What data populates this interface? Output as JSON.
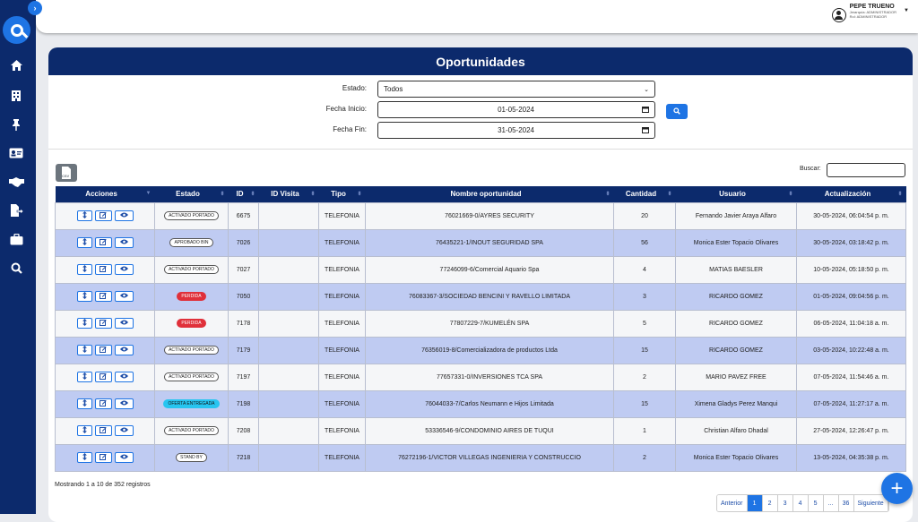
{
  "user": {
    "name": "PEPE TRUENO",
    "role_line": "Jerarquía: ADMINISTRADOR",
    "rol_line": "Rol: ADMINISTRADOR"
  },
  "page_title": "Oportunidades",
  "filters": {
    "estado_label": "Estado:",
    "estado_value": "Todos",
    "fecha_inicio_label": "Fecha Inicio:",
    "fecha_inicio_value": "01-05-2024",
    "fecha_fin_label": "Fecha Fin:",
    "fecha_fin_value": "31-05-2024"
  },
  "search_label": "Buscar:",
  "csv_label": "CSV",
  "columns": [
    "Acciones",
    "Estado",
    "ID",
    "ID Visita",
    "Tipo",
    "Nombre oportunidad",
    "Cantidad",
    "Usuario",
    "Actualización"
  ],
  "rows": [
    {
      "estado": "ACTIVADO PORTADO",
      "id": "6675",
      "id_visita": "",
      "tipo": "TELEFONIA",
      "nombre": "76021669-0/AYRES SECURITY",
      "cantidad": "20",
      "usuario": "Fernando Javier Araya Alfaro",
      "actualizacion": "30-05-2024, 06:04:54 p. m."
    },
    {
      "estado": "APROBADO BIN",
      "id": "7026",
      "id_visita": "",
      "tipo": "TELEFONIA",
      "nombre": "76435221-1/INOUT SEGURIDAD SPA",
      "cantidad": "56",
      "usuario": "Monica Ester Topacio Olivares",
      "actualizacion": "30-05-2024, 03:18:42 p. m."
    },
    {
      "estado": "ACTIVADO PORTADO",
      "id": "7027",
      "id_visita": "",
      "tipo": "TELEFONIA",
      "nombre": "77246099-6/Comercial Aquario Spa",
      "cantidad": "4",
      "usuario": "MATIAS BAESLER",
      "actualizacion": "10-05-2024, 05:18:50 p. m."
    },
    {
      "estado": "PERDIDA",
      "id": "7050",
      "id_visita": "",
      "tipo": "TELEFONIA",
      "nombre": "76083367-3/SOCIEDAD BENCINI Y RAVELLO LIMITADA",
      "cantidad": "3",
      "usuario": "RICARDO GOMEZ",
      "actualizacion": "01-05-2024, 09:04:56 p. m."
    },
    {
      "estado": "PERDIDA",
      "id": "7178",
      "id_visita": "",
      "tipo": "TELEFONIA",
      "nombre": "77807229-7/KUMELÉN SPA",
      "cantidad": "5",
      "usuario": "RICARDO GOMEZ",
      "actualizacion": "06-05-2024, 11:04:18 a. m."
    },
    {
      "estado": "ACTIVADO PORTADO",
      "id": "7179",
      "id_visita": "",
      "tipo": "TELEFONIA",
      "nombre": "76356019-8/Comercializadora de productos Ltda",
      "cantidad": "15",
      "usuario": "RICARDO GOMEZ",
      "actualizacion": "03-05-2024, 10:22:48 a. m."
    },
    {
      "estado": "ACTIVADO PORTADO",
      "id": "7197",
      "id_visita": "",
      "tipo": "TELEFONIA",
      "nombre": "77657331-0/INVERSIONES TCA SPA",
      "cantidad": "2",
      "usuario": "MARIO PAVEZ FREE",
      "actualizacion": "07-05-2024, 11:54:46 a. m."
    },
    {
      "estado": "OFERTA ENTREGADA",
      "id": "7198",
      "id_visita": "",
      "tipo": "TELEFONIA",
      "nombre": "76044033-7/Carlos Neumann e Hijos Limitada",
      "cantidad": "15",
      "usuario": "Ximena Gladys Perez Manqui",
      "actualizacion": "07-05-2024, 11:27:17 a. m."
    },
    {
      "estado": "ACTIVADO PORTADO",
      "id": "7208",
      "id_visita": "",
      "tipo": "TELEFONIA",
      "nombre": "53336546-9/CONDOMINIO AIRES DE TUQUI",
      "cantidad": "1",
      "usuario": "Christian Alfaro Dhadal",
      "actualizacion": "27-05-2024, 12:26:47 p. m."
    },
    {
      "estado": "STAND BY",
      "id": "7218",
      "id_visita": "",
      "tipo": "TELEFONIA",
      "nombre": "76272196-1/VICTOR VILLEGAS INGENIERIA Y CONSTRUCCIO",
      "cantidad": "2",
      "usuario": "Monica Ester Topacio Olivares",
      "actualizacion": "13-05-2024, 04:35:38 p. m."
    }
  ],
  "info_text": "Mostrando 1 a 10 de 352 registros",
  "pagination": [
    "Anterior",
    "1",
    "2",
    "3",
    "4",
    "5",
    "...",
    "36",
    "Siguiente"
  ],
  "fab_label": "+",
  "colors": {
    "navy": "#0c2a6c",
    "accent": "#1e74e4",
    "row_alt": "#bfcbf2",
    "perdida": "#e0303a",
    "oferta": "#27c5f0"
  }
}
